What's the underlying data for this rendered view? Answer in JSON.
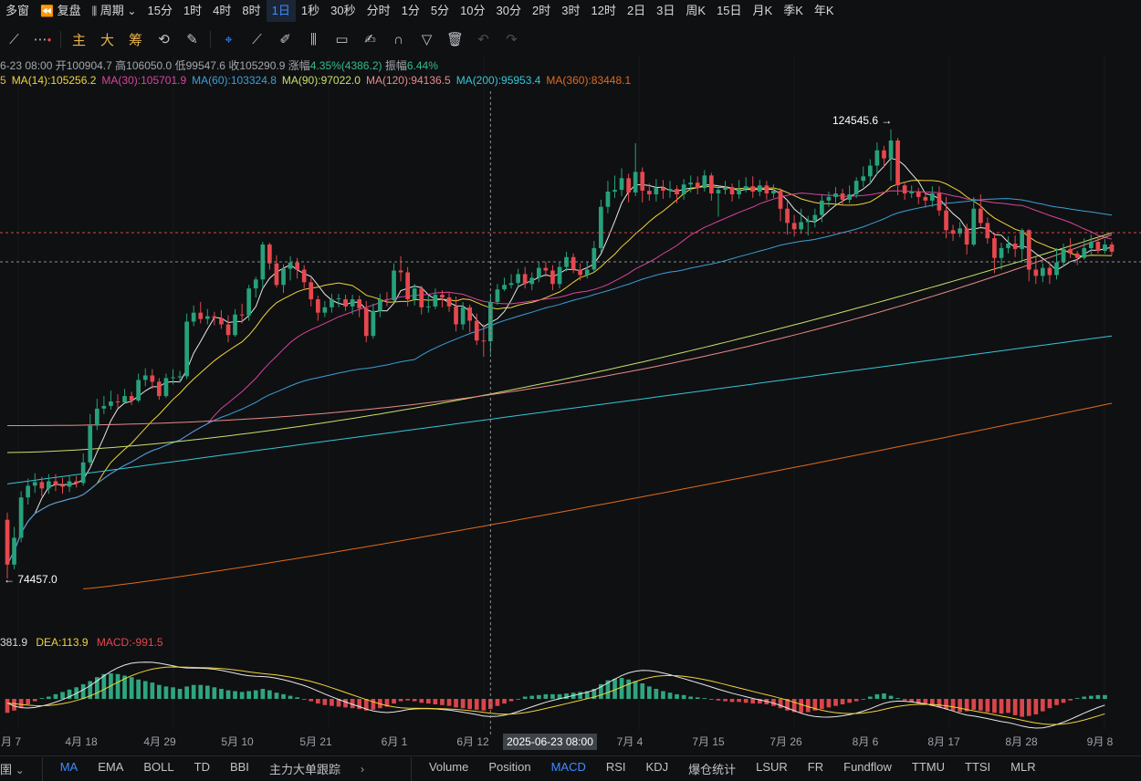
{
  "topbar": {
    "multi_window": "多窗",
    "replay": "复盘",
    "period": "周期",
    "intervals": [
      "15分",
      "1时",
      "4时",
      "8时",
      "1日",
      "1秒",
      "30秒",
      "分时",
      "1分",
      "5分",
      "10分",
      "30分",
      "2时",
      "3时",
      "12时",
      "2日",
      "3日",
      "周K",
      "15日",
      "月K",
      "季K",
      "年K"
    ],
    "active_interval": "1日"
  },
  "toolbar": {
    "main": "主",
    "big": "大",
    "chip": "筹"
  },
  "ohlc": {
    "date": "6-23 08:00",
    "open_label": "开",
    "open": "100904.7",
    "high_label": "高",
    "high": "106050.0",
    "low_label": "低",
    "low": "99547.6",
    "close_label": "收",
    "close": "105290.9",
    "change_label": "涨幅",
    "change": "4.35%(4386.2)",
    "amplitude_label": "振幅",
    "amplitude": "6.44%"
  },
  "ma_legend": {
    "partial": "5",
    "items": [
      {
        "text": "MA(14):105256.2",
        "color": "#f0d43a"
      },
      {
        "text": "MA(30):105701.9",
        "color": "#d9449c"
      },
      {
        "text": "MA(60):103324.8",
        "color": "#3aa0d8"
      },
      {
        "text": "MA(90):97022.0",
        "color": "#c8e06a"
      },
      {
        "text": "MA(120):94136.5",
        "color": "#e88a8a"
      },
      {
        "text": "MA(200):95953.4",
        "color": "#34c7d6"
      },
      {
        "text": "MA(360):83448.1",
        "color": "#e06a1c"
      }
    ]
  },
  "macd_legend": {
    "dif": "381.9",
    "dea": "DEA:113.9",
    "macd": "MACD:-991.5"
  },
  "annotations": {
    "high": "124545.6",
    "low": "74457.0"
  },
  "x_axis": {
    "labels": [
      "月 7",
      "4月 18",
      "4月 29",
      "5月 10",
      "5月 21",
      "6月 1",
      "6月 12",
      "7月 4",
      "7月 15",
      "7月 26",
      "8月 6",
      "8月 17",
      "8月 28",
      "9月 8"
    ],
    "crosshair_label": "2025-06-23 08:00"
  },
  "bottombar": {
    "left_tab": "圉",
    "main_indicators": [
      "MA",
      "EMA",
      "BOLL",
      "TD",
      "BBI",
      "主力大单跟踪"
    ],
    "active_main": "MA",
    "sub_indicators": [
      "Volume",
      "Position",
      "MACD",
      "RSI",
      "KDJ",
      "爆仓统计",
      "LSUR",
      "FR",
      "Fundflow",
      "TTMU",
      "TTSI",
      "MLR"
    ],
    "active_sub": "MACD"
  },
  "colors": {
    "up": "#26a17b",
    "down": "#e5484d",
    "bg": "#0f1012",
    "accent": "#3c8cff"
  },
  "chart_data": {
    "type": "candlestick",
    "price_high_label": 124545.6,
    "price_low_label": 74457.0,
    "ylim": [
      71000,
      129000
    ],
    "candles": [
      [
        81000,
        76000,
        81800,
        74457
      ],
      [
        76000,
        79000,
        80200,
        75500
      ],
      [
        79000,
        83500,
        84200,
        78500
      ],
      [
        83500,
        84800,
        85600,
        82700
      ],
      [
        84800,
        85200,
        86200,
        84000
      ],
      [
        85200,
        84500,
        85800,
        83600
      ],
      [
        84500,
        85300,
        86100,
        83900
      ],
      [
        85300,
        84900,
        86100,
        84200
      ],
      [
        84900,
        84700,
        85700,
        83900
      ],
      [
        84700,
        85300,
        86000,
        84100
      ],
      [
        85300,
        85100,
        85900,
        84600
      ],
      [
        85100,
        87400,
        88400,
        84800
      ],
      [
        87400,
        91500,
        92800,
        87100
      ],
      [
        91500,
        93400,
        94500,
        91000
      ],
      [
        93400,
        93700,
        94800,
        92800
      ],
      [
        93700,
        94200,
        95400,
        93300
      ],
      [
        94200,
        94100,
        95000,
        93500
      ],
      [
        94100,
        94800,
        95600,
        93900
      ],
      [
        94800,
        94300,
        95300,
        93800
      ],
      [
        94300,
        96600,
        97300,
        94100
      ],
      [
        96600,
        97100,
        97900,
        95900
      ],
      [
        97100,
        96400,
        97800,
        95600
      ],
      [
        96400,
        94800,
        96800,
        94400
      ],
      [
        94800,
        96800,
        97300,
        94600
      ],
      [
        96800,
        96900,
        97800,
        96100
      ],
      [
        96900,
        97000,
        97600,
        96300
      ],
      [
        97000,
        103100,
        104000,
        96700
      ],
      [
        103100,
        104100,
        104900,
        102600
      ],
      [
        104100,
        103400,
        105300,
        102900
      ],
      [
        103400,
        103700,
        104500,
        102800
      ],
      [
        103700,
        103500,
        104200,
        102700
      ],
      [
        103500,
        102800,
        104400,
        102300
      ],
      [
        102800,
        101600,
        103800,
        100800
      ],
      [
        101600,
        103900,
        104500,
        101400
      ],
      [
        103900,
        103800,
        105100,
        102900
      ],
      [
        103800,
        106800,
        107200,
        103200
      ],
      [
        106800,
        107800,
        108100,
        105800
      ],
      [
        107800,
        111700,
        112000,
        106800
      ],
      [
        111700,
        109600,
        111900,
        108900
      ],
      [
        109600,
        107200,
        110500,
        106900
      ],
      [
        107200,
        109000,
        109500,
        106300
      ],
      [
        109000,
        109700,
        110400,
        107700
      ],
      [
        109700,
        108900,
        110200,
        107900
      ],
      [
        108900,
        107500,
        109400,
        106800
      ],
      [
        107500,
        105600,
        108000,
        104800
      ],
      [
        105600,
        104100,
        106000,
        103200
      ],
      [
        104100,
        104700,
        105400,
        103600
      ],
      [
        104700,
        105600,
        106200,
        104100
      ],
      [
        105600,
        105700,
        106200,
        104700
      ],
      [
        105600,
        104800,
        106100,
        104300
      ],
      [
        104800,
        105600,
        106100,
        103900
      ],
      [
        105600,
        104600,
        106000,
        103600
      ],
      [
        104600,
        101500,
        105400,
        100800
      ],
      [
        101500,
        104300,
        105100,
        101200
      ],
      [
        104300,
        105600,
        106200,
        103600
      ],
      [
        105600,
        105500,
        106400,
        104800
      ],
      [
        105500,
        108800,
        109600,
        105200
      ],
      [
        108800,
        108600,
        110400,
        107600
      ],
      [
        108600,
        105600,
        109200,
        104800
      ],
      [
        105600,
        106800,
        107300,
        104900
      ],
      [
        106800,
        104700,
        107100,
        103900
      ],
      [
        104700,
        104800,
        106000,
        104100
      ],
      [
        104800,
        106100,
        106800,
        104500
      ],
      [
        106100,
        105800,
        106600,
        104700
      ],
      [
        105800,
        104800,
        106300,
        104200
      ],
      [
        104800,
        102800,
        105900,
        102000
      ],
      [
        102800,
        104700,
        105300,
        102200
      ],
      [
        104700,
        103200,
        105000,
        101900
      ],
      [
        103200,
        101000,
        104000,
        100500
      ],
      [
        101000,
        100900,
        102800,
        99200
      ],
      [
        100900,
        105300,
        106050,
        99547.6
      ],
      [
        105300,
        106700,
        107300,
        105000
      ],
      [
        106700,
        107200,
        108000,
        106500
      ],
      [
        107200,
        107400,
        108400,
        106800
      ],
      [
        107400,
        108400,
        109000,
        107100
      ],
      [
        108400,
        107300,
        109200,
        106800
      ],
      [
        107300,
        108000,
        108600,
        106600
      ],
      [
        108000,
        109100,
        109700,
        107500
      ],
      [
        109100,
        108800,
        109800,
        108100
      ],
      [
        108800,
        107300,
        109400,
        106600
      ],
      [
        107300,
        109200,
        109800,
        106800
      ],
      [
        109200,
        110300,
        110900,
        108700
      ],
      [
        110300,
        108900,
        110700,
        108500
      ],
      [
        108900,
        108300,
        109600,
        107700
      ],
      [
        108300,
        108900,
        109800,
        107900
      ],
      [
        108900,
        111300,
        112100,
        108600
      ],
      [
        111300,
        115900,
        116700,
        110800
      ],
      [
        115900,
        117600,
        118800,
        115200
      ],
      [
        117600,
        117800,
        119400,
        116900
      ],
      [
        117800,
        119100,
        120200,
        117100
      ],
      [
        119100,
        117500,
        119600,
        116400
      ],
      [
        117500,
        119800,
        123000,
        117100
      ],
      [
        119800,
        117700,
        120300,
        116400
      ],
      [
        117700,
        117300,
        118500,
        116600
      ],
      [
        117300,
        118000,
        119000,
        116500
      ],
      [
        118000,
        117700,
        118900,
        116800
      ],
      [
        117700,
        117900,
        118800,
        116900
      ],
      [
        117900,
        117300,
        118300,
        116300
      ],
      [
        117300,
        118400,
        119000,
        116700
      ],
      [
        118400,
        118600,
        119400,
        117500
      ],
      [
        118600,
        118000,
        119300,
        117300
      ],
      [
        118000,
        119400,
        120000,
        117600
      ],
      [
        119400,
        117400,
        119700,
        116600
      ],
      [
        117400,
        117800,
        118200,
        114800
      ],
      [
        117800,
        118100,
        118800,
        117300
      ],
      [
        118100,
        117300,
        118500,
        116500
      ],
      [
        117300,
        117900,
        118900,
        116800
      ],
      [
        117900,
        118200,
        119200,
        117500
      ],
      [
        118200,
        117600,
        119300,
        116900
      ],
      [
        117600,
        118300,
        118900,
        117100
      ],
      [
        118300,
        117400,
        118800,
        116700
      ],
      [
        117400,
        117700,
        118400,
        116900
      ],
      [
        117700,
        115700,
        118000,
        114300
      ],
      [
        115700,
        114100,
        116600,
        112800
      ],
      [
        114100,
        113400,
        115000,
        112600
      ],
      [
        113400,
        114200,
        115700,
        112900
      ],
      [
        114200,
        114400,
        114900,
        112700
      ],
      [
        114400,
        115000,
        115700,
        113600
      ],
      [
        115000,
        116600,
        117300,
        114200
      ],
      [
        116600,
        117000,
        117600,
        115900
      ],
      [
        117000,
        117400,
        118100,
        116300
      ],
      [
        117400,
        116700,
        117900,
        116100
      ],
      [
        116700,
        117300,
        118300,
        116300
      ],
      [
        117300,
        118800,
        119200,
        116900
      ],
      [
        118800,
        119300,
        120400,
        118100
      ],
      [
        119300,
        120500,
        121200,
        118500
      ],
      [
        120500,
        122200,
        123100,
        119500
      ],
      [
        122200,
        121300,
        122700,
        120300
      ],
      [
        121300,
        123300,
        124545.6,
        118800
      ],
      [
        123300,
        118300,
        123600,
        117200
      ],
      [
        118300,
        117400,
        118700,
        116700
      ],
      [
        117400,
        117600,
        118300,
        116900
      ],
      [
        117600,
        117000,
        118000,
        116200
      ],
      [
        117000,
        116600,
        117600,
        115800
      ],
      [
        116600,
        117400,
        118200,
        115900
      ],
      [
        117400,
        115500,
        118200,
        114900
      ],
      [
        115500,
        113300,
        117000,
        112400
      ],
      [
        113300,
        112900,
        113900,
        112100
      ],
      [
        112900,
        113500,
        114200,
        112500
      ],
      [
        113500,
        111700,
        114000,
        110600
      ],
      [
        111700,
        115700,
        117000,
        111500
      ],
      [
        115700,
        114100,
        117300,
        113600
      ],
      [
        114100,
        112400,
        114700,
        111800
      ],
      [
        112400,
        110200,
        113000,
        108500
      ],
      [
        110200,
        111300,
        111900,
        108900
      ],
      [
        111300,
        111800,
        112600,
        110700
      ],
      [
        111800,
        111200,
        112700,
        110300
      ],
      [
        111200,
        113300,
        113500,
        109700
      ],
      [
        113300,
        108900,
        113400,
        107600
      ],
      [
        108900,
        108200,
        110300,
        107300
      ],
      [
        108200,
        109100,
        109600,
        107500
      ],
      [
        109100,
        108300,
        109800,
        107300
      ],
      [
        108300,
        109700,
        111300,
        107800
      ],
      [
        109700,
        111200,
        111800,
        109300
      ],
      [
        111200,
        110700,
        112400,
        110200
      ],
      [
        110700,
        110200,
        111000,
        109400
      ],
      [
        110200,
        111300,
        112400,
        110000
      ],
      [
        111300,
        112000,
        112800,
        110600
      ],
      [
        112000,
        111000,
        112600,
        110700
      ],
      [
        111000,
        111700,
        112300,
        110700
      ],
      [
        111700,
        110900,
        112000,
        110500
      ]
    ],
    "macd_hist": [
      -1800,
      -1500,
      -1100,
      -700,
      -300,
      100,
      300,
      600,
      900,
      1200,
      1500,
      1900,
      2300,
      2800,
      3200,
      3300,
      3200,
      3000,
      2800,
      2500,
      2300,
      2100,
      1800,
      1600,
      1500,
      1300,
      1600,
      1800,
      1800,
      1700,
      1500,
      1300,
      1100,
      1000,
      900,
      1000,
      1100,
      1300,
      1100,
      800,
      600,
      400,
      200,
      0,
      -300,
      -600,
      -800,
      -900,
      -1000,
      -1100,
      -1200,
      -1300,
      -1500,
      -1400,
      -1200,
      -1000,
      -600,
      -300,
      -200,
      -300,
      -500,
      -600,
      -700,
      -800,
      -900,
      -1100,
      -1200,
      -1300,
      -1400,
      -1500,
      -1300,
      -900,
      -600,
      -300,
      0,
      300,
      400,
      500,
      600,
      600,
      600,
      700,
      800,
      900,
      1000,
      1300,
      1900,
      2400,
      2600,
      2700,
      2500,
      2300,
      2000,
      1600,
      1300,
      1000,
      800,
      600,
      500,
      300,
      200,
      100,
      -100,
      -200,
      -300,
      -400,
      -400,
      -500,
      -600,
      -600,
      -700,
      -900,
      -1200,
      -1500,
      -1700,
      -1800,
      -1700,
      -1500,
      -1300,
      -1100,
      -900,
      -700,
      -500,
      -300,
      0,
      300,
      600,
      700,
      400,
      100,
      -200,
      -400,
      -600,
      -700,
      -900,
      -1100,
      -1300,
      -1500,
      -1700,
      -1600,
      -1400,
      -1500,
      -1700,
      -1800,
      -1900,
      -1800,
      -2100,
      -2300,
      -2200,
      -2000,
      -1600,
      -1200,
      -800,
      -500,
      -200,
      100,
      300,
      400,
      500,
      500
    ]
  }
}
